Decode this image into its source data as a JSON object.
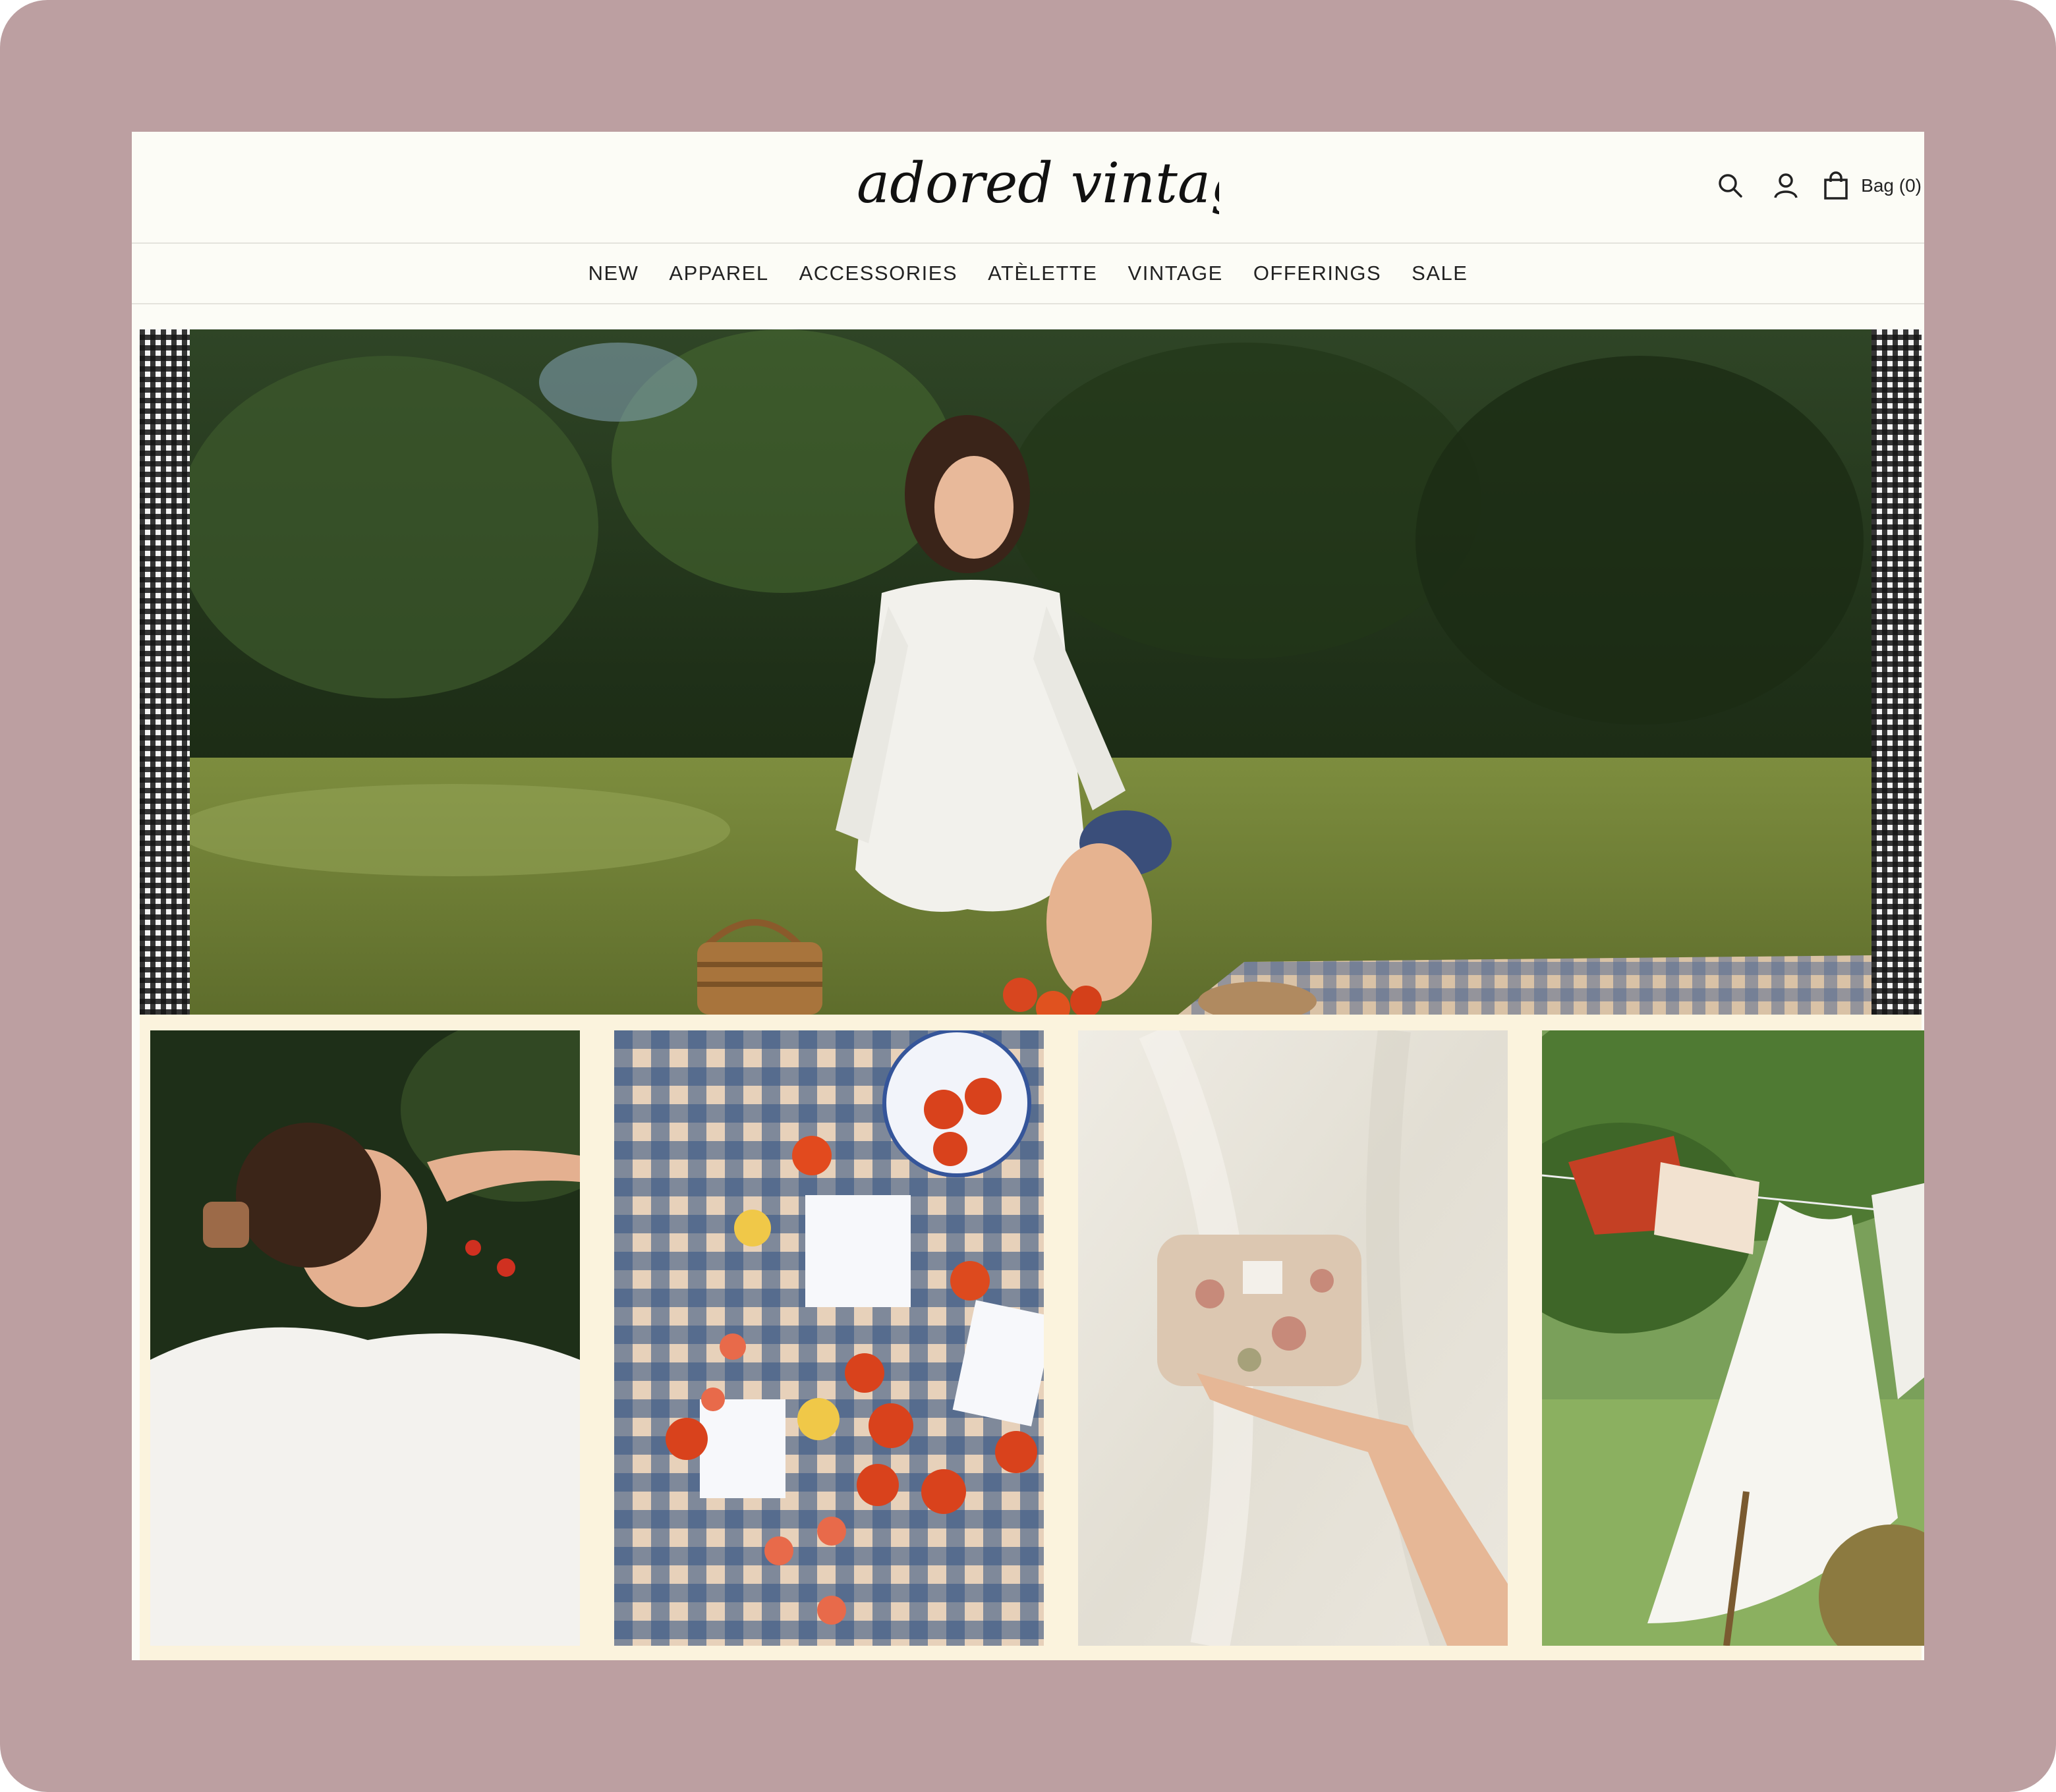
{
  "header": {
    "logo_text": "adored vintage",
    "search_icon": "search-icon",
    "account_icon": "user-icon",
    "bag_icon": "shopping-bag-icon",
    "bag_label": "Bag (0)"
  },
  "nav": {
    "items": [
      "NEW",
      "APPAREL",
      "ACCESSORIES",
      "ATÈLETTE",
      "VINTAGE",
      "OFFERINGS",
      "SALE"
    ]
  },
  "hero": {
    "image": "woman-picnic-basket-photo"
  },
  "gallery": {
    "tiles": [
      "woman-eating-cherries-photo",
      "gingham-tomatoes-cards-photo",
      "floral-pouch-photo",
      "clothesline-dress-photo"
    ]
  },
  "colors": {
    "frame_background": "#bc9fa1",
    "page_background": "#fcfcf6",
    "grid_background": "#fbf3dd",
    "text": "#222222"
  }
}
